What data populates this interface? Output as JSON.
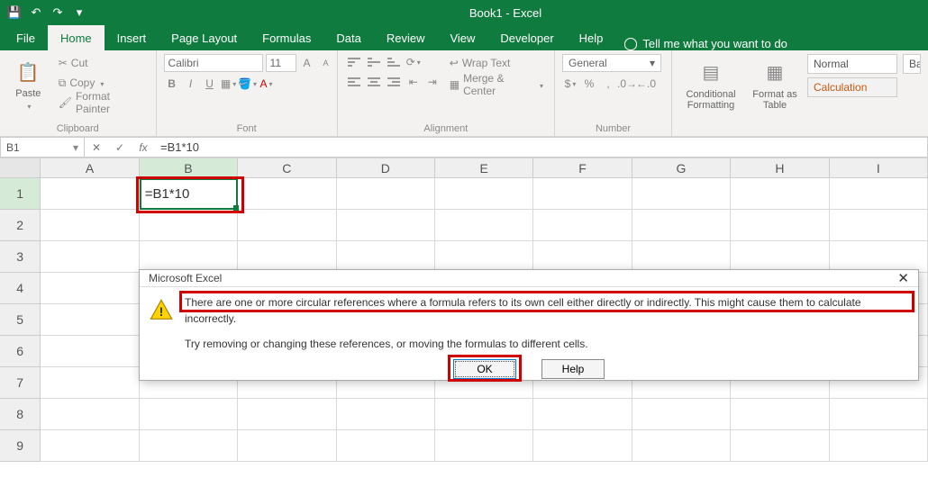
{
  "title": "Book1 - Excel",
  "qat": {
    "save": "💾",
    "undo": "↶",
    "redo": "↷",
    "custom": "▾"
  },
  "tabs": [
    "File",
    "Home",
    "Insert",
    "Page Layout",
    "Formulas",
    "Data",
    "Review",
    "View",
    "Developer",
    "Help"
  ],
  "active_tab": "Home",
  "tell_me": "Tell me what you want to do",
  "ribbon": {
    "clipboard": {
      "label": "Clipboard",
      "paste": "Paste",
      "cut": "Cut",
      "copy": "Copy",
      "format_painter": "Format Painter"
    },
    "font": {
      "label": "Font",
      "name": "Calibri",
      "size": "11"
    },
    "alignment": {
      "label": "Alignment",
      "wrap": "Wrap Text",
      "merge": "Merge & Center"
    },
    "number": {
      "label": "Number",
      "format": "General"
    },
    "styles": {
      "cond": "Conditional Formatting",
      "table": "Format as Table",
      "normal": "Normal",
      "bad": "Ba",
      "calc": "Calculation"
    }
  },
  "name_box": "B1",
  "formula": "=B1*10",
  "columns": [
    "A",
    "B",
    "C",
    "D",
    "E",
    "F",
    "G",
    "H",
    "I"
  ],
  "rows": [
    "1",
    "2",
    "3",
    "4",
    "5",
    "6",
    "7",
    "8",
    "9"
  ],
  "cell_B1": "=B1*10",
  "dialog": {
    "title": "Microsoft Excel",
    "line1": "There are one or more circular references where a formula refers to its own cell either directly or indirectly. This might cause them to calculate incorrectly.",
    "line2": "Try removing or changing these references, or moving the formulas to different cells.",
    "ok": "OK",
    "help": "Help"
  }
}
